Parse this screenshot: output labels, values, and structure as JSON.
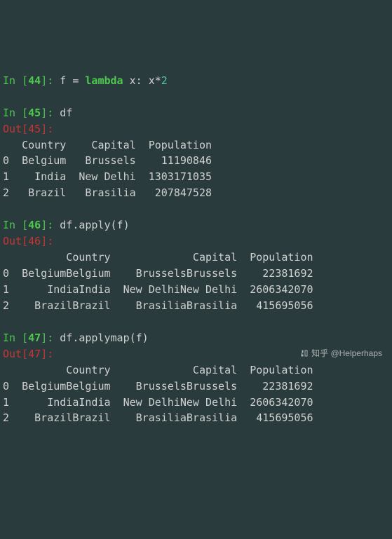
{
  "cells": [
    {
      "in_num": "44",
      "code_parts": {
        "p1": "f = ",
        "kw": "lambda",
        "p2": " x: x*",
        "num": "2"
      }
    },
    {
      "in_num": "45",
      "code": "df",
      "out_num": "45",
      "table": {
        "header": "   Country    Capital  Population",
        "rows": [
          "0  Belgium   Brussels    11190846",
          "1    India  New Delhi  1303171035",
          "2   Brazil   Brasilia   207847528"
        ]
      }
    },
    {
      "in_num": "46",
      "code": "df.apply(f)",
      "out_num": "46",
      "table": {
        "header": "          Country             Capital  Population",
        "rows": [
          "0  BelgiumBelgium    BrusselsBrussels    22381692",
          "1      IndiaIndia  New DelhiNew Delhi  2606342070",
          "2    BrazilBrazil    BrasiliaBrasilia   415695056"
        ]
      }
    },
    {
      "in_num": "47",
      "code": "df.applymap(f)",
      "out_num": "47",
      "table": {
        "header": "          Country             Capital  Population",
        "rows": [
          "0  BelgiumBelgium    BrusselsBrussels    22381692",
          "1      IndiaIndia  New DelhiNew Delhi  2606342070",
          "2    BrazilBrazil    BrasiliaBrasilia   415695056"
        ]
      }
    }
  ],
  "prompt": {
    "in_open": "In [",
    "in_close": "]: ",
    "out_open": "Out[",
    "out_close": "]: "
  },
  "watermark": "知乎 @Helperhaps",
  "chart_data": {
    "type": "table",
    "tables": [
      {
        "name": "df",
        "columns": [
          "Country",
          "Capital",
          "Population"
        ],
        "rows": [
          [
            "Belgium",
            "Brussels",
            11190846
          ],
          [
            "India",
            "New Delhi",
            1303171035
          ],
          [
            "Brazil",
            "Brasilia",
            207847528
          ]
        ]
      },
      {
        "name": "df.apply(f)",
        "columns": [
          "Country",
          "Capital",
          "Population"
        ],
        "rows": [
          [
            "BelgiumBelgium",
            "BrusselsBrussels",
            22381692
          ],
          [
            "IndiaIndia",
            "New DelhiNew Delhi",
            2606342070
          ],
          [
            "BrazilBrazil",
            "BrasiliaBrasilia",
            415695056
          ]
        ]
      },
      {
        "name": "df.applymap(f)",
        "columns": [
          "Country",
          "Capital",
          "Population"
        ],
        "rows": [
          [
            "BelgiumBelgium",
            "BrusselsBrussels",
            22381692
          ],
          [
            "IndiaIndia",
            "New DelhiNew Delhi",
            2606342070
          ],
          [
            "BrazilBrazil",
            "BrasiliaBrasilia",
            415695056
          ]
        ]
      }
    ]
  }
}
